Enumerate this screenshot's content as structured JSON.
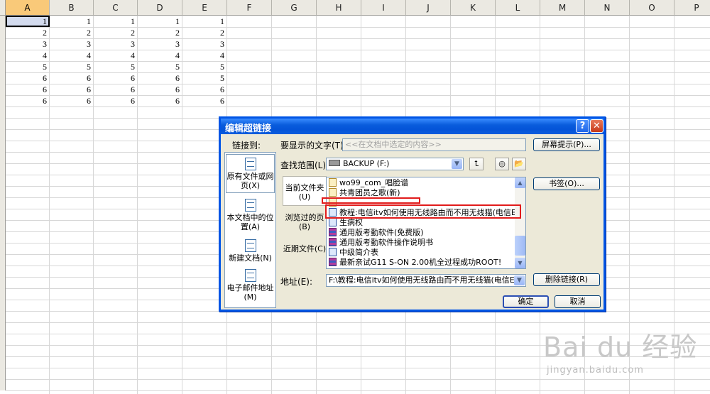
{
  "spreadsheet": {
    "columns": [
      "A",
      "B",
      "C",
      "D",
      "E",
      "F",
      "G",
      "H",
      "I",
      "J",
      "K",
      "L",
      "M",
      "N",
      "O",
      "P"
    ],
    "rows": [
      [
        1,
        1,
        1,
        1,
        1
      ],
      [
        2,
        2,
        2,
        2,
        2
      ],
      [
        3,
        3,
        3,
        3,
        3
      ],
      [
        4,
        4,
        4,
        4,
        4
      ],
      [
        5,
        5,
        5,
        5,
        5
      ],
      [
        6,
        6,
        6,
        6,
        5
      ],
      [
        6,
        6,
        6,
        6,
        6
      ],
      [
        6,
        6,
        6,
        6,
        6
      ]
    ]
  },
  "dialog": {
    "title": "编辑超链接",
    "help_button": "?",
    "close_button": "✕",
    "link_to_label": "链接到:",
    "link_to_items": [
      "原有文件或网页(X)",
      "本文档中的位置(A)",
      "新建文档(N)",
      "电子邮件地址(M)"
    ],
    "display_text_label": "要显示的文字(T):",
    "display_text_value": "<<在文档中选定的内容>>",
    "screentip_button": "屏幕提示(P)...",
    "look_in_label": "查找范围(L):",
    "look_in_value": "BACKUP (F:)",
    "bookmark_button": "书签(O)...",
    "look_in_items": [
      "当前文件夹(U)",
      "浏览过的页(B)",
      "近期文件(C)"
    ],
    "files": [
      {
        "name": "wo99_com_唱脸谱",
        "icon": "music-file-icon"
      },
      {
        "name": "共青团员之歌(新)",
        "icon": "music-file-icon"
      },
      {
        "name": "",
        "icon": "music-file-icon"
      },
      {
        "name": "教程:电信itv如何使用无线路由而不用无线猫(电信E",
        "icon": "document-file-icon"
      },
      {
        "name": "生病权",
        "icon": "document-file-icon"
      },
      {
        "name": "通用版考勤软件(免费版)",
        "icon": "archive-file-icon"
      },
      {
        "name": "通用版考勤软件操作说明书",
        "icon": "archive-file-icon"
      },
      {
        "name": "中级简介表",
        "icon": "document-file-icon"
      },
      {
        "name": "最新亲试G11 S-ON 2.00机全过程成功ROOT!",
        "icon": "archive-file-icon"
      }
    ],
    "address_label": "地址(E):",
    "address_value": "F:\\教程:电信itv如何使用无线路由而不用无线猫(电信E",
    "remove_link_button": "删除链接(R)",
    "ok_button": "确定",
    "cancel_button": "取消"
  },
  "watermark": {
    "text": "Bai du 经验",
    "sub": "jingyan.baidu.com"
  },
  "colors": {
    "title_bar": "#0a5ddd",
    "dialog_bg": "#ece9d8",
    "highlight_red": "#e11b1b",
    "selected_column_header": "#f9c979"
  }
}
